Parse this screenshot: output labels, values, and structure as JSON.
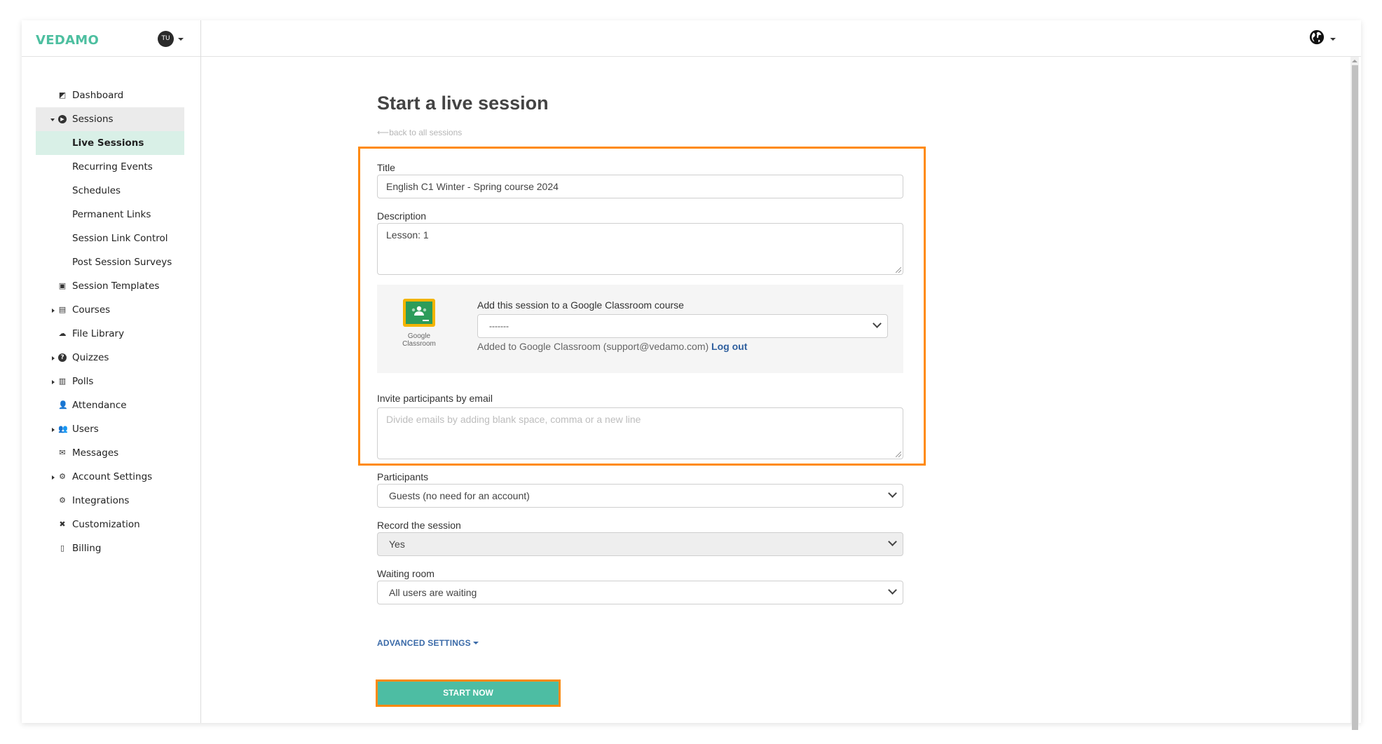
{
  "brand": {
    "logo_text": "VEDAMO",
    "accent_color": "#4dbfa0"
  },
  "user": {
    "avatar_initials": "TU"
  },
  "header": {
    "language_icon": "globe-icon"
  },
  "sidebar": {
    "items": [
      {
        "label": "Dashboard",
        "icon": "dashboard-icon",
        "expandable": false
      },
      {
        "label": "Sessions",
        "icon": "play-circle-icon",
        "expandable": true,
        "expanded": true
      },
      {
        "label": "Live Sessions",
        "sub": true,
        "active": true
      },
      {
        "label": "Recurring Events",
        "sub": true
      },
      {
        "label": "Schedules",
        "sub": true
      },
      {
        "label": "Permanent Links",
        "sub": true
      },
      {
        "label": "Session Link Control",
        "sub": true
      },
      {
        "label": "Post Session Surveys",
        "sub": true
      },
      {
        "label": "Session Templates",
        "icon": "template-icon",
        "expandable": false
      },
      {
        "label": "Courses",
        "icon": "book-icon",
        "expandable": true
      },
      {
        "label": "File Library",
        "icon": "cloud-upload-icon",
        "expandable": false
      },
      {
        "label": "Quizzes",
        "icon": "question-circle-icon",
        "expandable": true
      },
      {
        "label": "Polls",
        "icon": "bar-chart-icon",
        "expandable": true
      },
      {
        "label": "Attendance",
        "icon": "user-check-icon",
        "expandable": false
      },
      {
        "label": "Users",
        "icon": "users-icon",
        "expandable": true
      },
      {
        "label": "Messages",
        "icon": "envelope-icon",
        "expandable": false
      },
      {
        "label": "Account Settings",
        "icon": "gear-icon",
        "expandable": true
      },
      {
        "label": "Integrations",
        "icon": "cogs-icon",
        "expandable": false
      },
      {
        "label": "Customization",
        "icon": "tools-icon",
        "expandable": false
      },
      {
        "label": "Billing",
        "icon": "invoice-icon",
        "expandable": false
      }
    ]
  },
  "main": {
    "title": "Start a live session",
    "back_link": "back to all sessions",
    "form": {
      "title_label": "Title",
      "title_value": "English C1 Winter - Spring course 2024",
      "description_label": "Description",
      "description_value": "Lesson: 1",
      "google_classroom": {
        "caption": "Google Classroom",
        "label": "Add this session to a Google Classroom course",
        "selected": "-------",
        "status_text": "Added to Google Classroom (support@vedamo.com)",
        "logout_label": "Log out"
      },
      "invite_label": "Invite participants by email",
      "invite_placeholder": "Divide emails by adding blank space, comma or a new line",
      "participants_label": "Participants",
      "participants_value": "Guests (no need for an account)",
      "record_label": "Record the session",
      "record_value": "Yes",
      "waiting_label": "Waiting room",
      "waiting_value": "All users are waiting",
      "advanced_label": "ADVANCED SETTINGS",
      "start_label": "START NOW"
    }
  },
  "colors": {
    "highlight": "#ff8a0d",
    "button": "#4dbda3",
    "link": "#2f5f9e"
  }
}
